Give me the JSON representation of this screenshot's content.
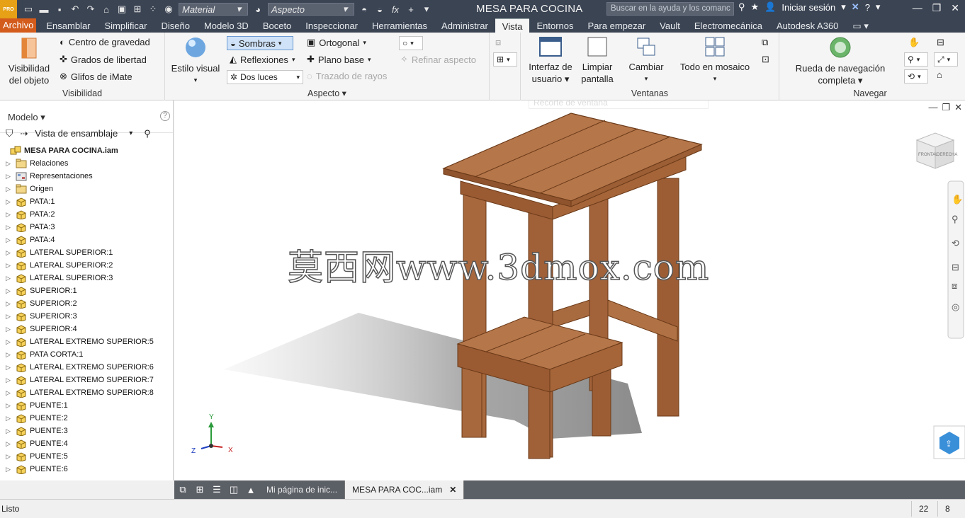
{
  "titlebar": {
    "logo_text": "PRO",
    "material_placeholder": "Material",
    "appearance_placeholder": "Aspecto",
    "fx": "fx",
    "title": "MESA PARA COCINA",
    "help_search": "Buscar en la ayuda y los comanc",
    "signin": "Iniciar sesión"
  },
  "tabs": [
    "Archivo",
    "Ensamblar",
    "Simplificar",
    "Diseño",
    "Modelo 3D",
    "Boceto",
    "Inspeccionar",
    "Herramientas",
    "Administrar",
    "Vista",
    "Entornos",
    "Para empezar",
    "Vault",
    "Electromecánica",
    "Autodesk A360"
  ],
  "ribbon": {
    "visibilidad": {
      "label": "Visibilidad",
      "object_btn": "Visibilidad del objeto",
      "items": [
        "Centro de gravedad",
        "Grados de libertad",
        "Glifos de iMate"
      ]
    },
    "aspecto": {
      "label": "Aspecto",
      "estilo_visual": "Estilo visual",
      "sombras": "Sombras",
      "reflexiones": "Reflexiones",
      "dos_luces": "Dos luces",
      "ortogonal": "Ortogonal",
      "plano_base": "Plano base",
      "trazado": "Trazado de rayos",
      "refinar": "Refinar aspecto"
    },
    "ventanas": {
      "label": "Ventanas",
      "interfaz": "Interfaz de usuario",
      "limpiar": "Limpiar pantalla",
      "cambiar": "Cambiar",
      "mosaico": "Todo en mosaico",
      "recorte": "Recorte de ventana"
    },
    "navegar": {
      "label": "Navegar",
      "rueda": "Rueda de navegación completa"
    }
  },
  "browser": {
    "title": "Modelo",
    "view": "Vista de ensamblaje",
    "root": "MESA PARA COCINA.iam",
    "items": [
      {
        "name": "Relaciones",
        "icon": "folder"
      },
      {
        "name": "Representaciones",
        "icon": "folder-rep"
      },
      {
        "name": "Origen",
        "icon": "folder"
      },
      {
        "name": "PATA:1",
        "icon": "part"
      },
      {
        "name": "PATA:2",
        "icon": "part"
      },
      {
        "name": "PATA:3",
        "icon": "part"
      },
      {
        "name": "PATA:4",
        "icon": "part"
      },
      {
        "name": "LATERAL SUPERIOR:1",
        "icon": "part"
      },
      {
        "name": "LATERAL SUPERIOR:2",
        "icon": "part"
      },
      {
        "name": "LATERAL SUPERIOR:3",
        "icon": "part"
      },
      {
        "name": "SUPERIOR:1",
        "icon": "part"
      },
      {
        "name": "SUPERIOR:2",
        "icon": "part"
      },
      {
        "name": "SUPERIOR:3",
        "icon": "part"
      },
      {
        "name": "SUPERIOR:4",
        "icon": "part"
      },
      {
        "name": "LATERAL EXTREMO SUPERIOR:5",
        "icon": "part"
      },
      {
        "name": "PATA CORTA:1",
        "icon": "part"
      },
      {
        "name": "LATERAL EXTREMO SUPERIOR:6",
        "icon": "part"
      },
      {
        "name": "LATERAL EXTREMO SUPERIOR:7",
        "icon": "part"
      },
      {
        "name": "LATERAL EXTREMO SUPERIOR:8",
        "icon": "part"
      },
      {
        "name": "PUENTE:1",
        "icon": "part"
      },
      {
        "name": "PUENTE:2",
        "icon": "part"
      },
      {
        "name": "PUENTE:3",
        "icon": "part"
      },
      {
        "name": "PUENTE:4",
        "icon": "part"
      },
      {
        "name": "PUENTE:5",
        "icon": "part"
      },
      {
        "name": "PUENTE:6",
        "icon": "part"
      }
    ]
  },
  "viewport": {
    "watermark": "莫西网www.3dmox.com",
    "viewcube_front": "FRONTAL",
    "viewcube_right": "DERECHA",
    "axis_x": "X",
    "axis_y": "Y",
    "axis_z": "Z"
  },
  "doctabs": {
    "home": "Mi página de inic...",
    "active": "MESA PARA COC...iam",
    "close": "✕"
  },
  "status": {
    "text": "Listo",
    "num1": "22",
    "num2": "8"
  },
  "colors": {
    "title_bg": "#3b4453",
    "file_tab": "#d35b1b",
    "wood": "#a8673a",
    "wood_dark": "#7a4320",
    "shadow": "#8e8e8e"
  }
}
